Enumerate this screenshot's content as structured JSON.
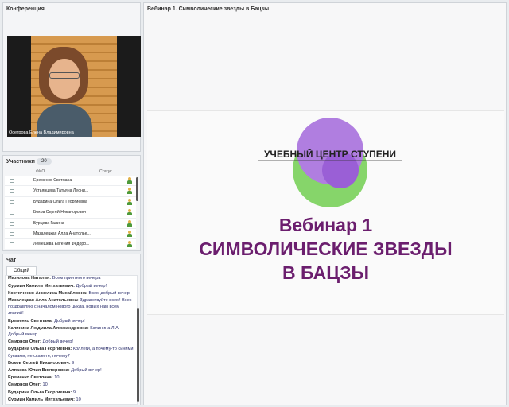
{
  "conference": {
    "title": "Конференция",
    "video_caption": "Осетрова Елена Владимировна"
  },
  "participants": {
    "title": "Участники",
    "count": "20",
    "col_fio": "ФИО",
    "col_status": "Статус",
    "items": [
      "Еременко Светлана",
      "Устьянцева Татьяна Леони...",
      "Бударина Ольга Георгиевна",
      "Боков Сергей Никанорович",
      "Бурцева Галина",
      "Мазалецкая Алла Анатолье...",
      "Лемешева Евгения Федоро..."
    ]
  },
  "chat": {
    "title": "Чат",
    "tab": "Общий",
    "messages": [
      {
        "author": "Мазилова Наталья:",
        "text": "Всем приятного вечера"
      },
      {
        "author": "Сурмин Камиль Митхатьевич:",
        "text": "Добрый вечер!"
      },
      {
        "author": "Костюченко Анжелика Михайловна:",
        "text": "Всем добрый вечер!"
      },
      {
        "author": "Мазалецкая Алла Анатольевна:",
        "text": "Здравствуйте всем! Всех поздравляю с началом нового цикла, новых нам всем знаний!"
      },
      {
        "author": "Еременко Светлана:",
        "text": "Добрый вечер!"
      },
      {
        "author": "Калинина Людмила Александровна:",
        "text": "Калинина Л.А. Добрый вечер"
      },
      {
        "author": "Смирнов Олег:",
        "text": "Добрый вечер!"
      },
      {
        "author": "Бударина Ольга Георгиевна:",
        "text": "Коллеги, а почему-то синими буквами, не скажете, почему?"
      },
      {
        "author": "Боков Сергей Никанорович:",
        "text": "9"
      },
      {
        "author": "Алпаева Юлия Викторовна:",
        "text": "Добрый вечер!"
      },
      {
        "author": "Еременко Светлана:",
        "text": "10"
      },
      {
        "author": "Смирнов Олег:",
        "text": "10"
      },
      {
        "author": "Бударина Ольга Георгиевна:",
        "text": "9"
      },
      {
        "author": "Сурмин Камиль Митхатьевич:",
        "text": "10"
      }
    ]
  },
  "webinar": {
    "title": "Вебинар 1. Символические звезды в Бацзы",
    "logo_text": "УЧЕБНЫЙ ЦЕНТР СТУПЕНИ",
    "slide_line1": "Вебинар 1",
    "slide_line2": "СИМВОЛИЧЕСКИЕ ЗВЕЗДЫ",
    "slide_line3": "В БАЦЗЫ",
    "colors": {
      "slide_text": "#6b1e6e",
      "logo_purple": "#b07ee0",
      "logo_green": "#86d56a"
    }
  }
}
